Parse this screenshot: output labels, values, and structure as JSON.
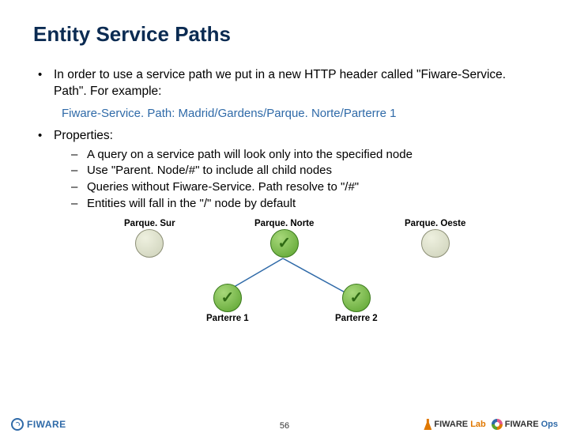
{
  "title": "Entity Service Paths",
  "bullets": {
    "b1": "In order to use a service path we put in a new HTTP header called \"Fiware-Service. Path\". For example:",
    "example": "Fiware-Service. Path: Madrid/Gardens/Parque. Norte/Parterre 1",
    "b2": "Properties:",
    "sub": {
      "s1": "A query on a service path will look only into the specified node",
      "s2": "Use \"Parent. Node/#\" to include all child nodes",
      "s3": "Queries without Fiware-Service. Path resolve to \"/#\"",
      "s4": "Entities will fall in the \"/\" node by default"
    }
  },
  "diagram": {
    "parqueSur": "Parque. Sur",
    "parqueNorte": "Parque. Norte",
    "parqueOeste": "Parque. Oeste",
    "parterre1": "Parterre 1",
    "parterre2": "Parterre 2"
  },
  "footer": {
    "pageNumber": "56",
    "fiware": "FIWARE",
    "lab_prefix": "FIWARE",
    "lab_suffix": "Lab",
    "ops_prefix": "FIWARE",
    "ops_suffix": "Ops"
  }
}
